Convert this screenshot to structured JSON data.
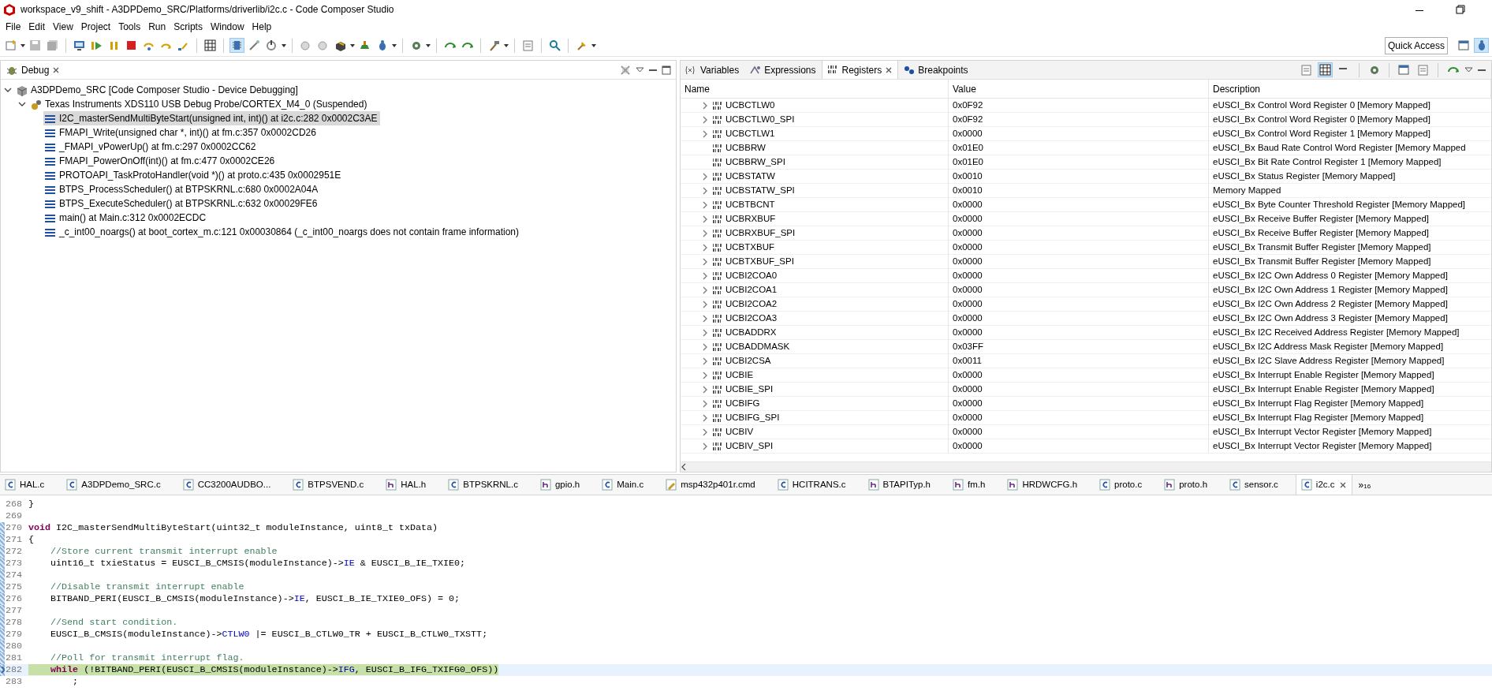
{
  "window": {
    "title": "workspace_v9_shift - A3DPDemo_SRC/Platforms/driverlib/i2c.c - Code Composer Studio"
  },
  "menu": [
    "File",
    "Edit",
    "View",
    "Project",
    "Tools",
    "Run",
    "Scripts",
    "Window",
    "Help"
  ],
  "toolbar": {
    "quick_access": "Quick Access"
  },
  "debug_view": {
    "title": "Debug",
    "tree": [
      {
        "label": "A3DPDemo_SRC [Code Composer Studio - Device Debugging]",
        "kind": "launch",
        "expanded": true,
        "selected": false,
        "children": [
          {
            "label": "Texas Instruments XDS110 USB Debug Probe/CORTEX_M4_0 (Suspended)",
            "kind": "target",
            "expanded": true,
            "selected": false,
            "children": [
              {
                "label": "I2C_masterSendMultiByteStart(unsigned int, int)() at i2c.c:282 0x0002C3AE",
                "kind": "frame",
                "selected": true
              },
              {
                "label": "FMAPI_Write(unsigned char *, int)() at fm.c:357 0x0002CD26",
                "kind": "frame",
                "selected": false
              },
              {
                "label": "_FMAPI_vPowerUp() at fm.c:297 0x0002CC62",
                "kind": "frame",
                "selected": false
              },
              {
                "label": "FMAPI_PowerOnOff(int)() at fm.c:477 0x0002CE26",
                "kind": "frame",
                "selected": false
              },
              {
                "label": "PROTOAPI_TaskProtoHandler(void *)() at proto.c:435 0x0002951E",
                "kind": "frame",
                "selected": false
              },
              {
                "label": "BTPS_ProcessScheduler() at BTPSKRNL.c:680 0x0002A04A",
                "kind": "frame",
                "selected": false
              },
              {
                "label": "BTPS_ExecuteScheduler() at BTPSKRNL.c:632 0x00029FE6",
                "kind": "frame",
                "selected": false
              },
              {
                "label": "main() at Main.c:312 0x0002ECDC",
                "kind": "frame",
                "selected": false
              },
              {
                "label": "_c_int00_noargs() at boot_cortex_m.c:121 0x00030864  (_c_int00_noargs does not contain frame information)",
                "kind": "frame",
                "selected": false
              }
            ]
          }
        ]
      }
    ]
  },
  "registers_view": {
    "tabs": [
      {
        "label": "Variables",
        "kind": "variables",
        "selected": false
      },
      {
        "label": "Expressions",
        "kind": "expressions",
        "selected": false
      },
      {
        "label": "Registers",
        "kind": "registers",
        "selected": true
      },
      {
        "label": "Breakpoints",
        "kind": "breakpoints",
        "selected": false
      }
    ],
    "columns": [
      "Name",
      "Value",
      "Description"
    ],
    "rows": [
      {
        "name": "UCBCTLW0",
        "value": "0x0F92",
        "description": "eUSCI_Bx Control Word Register 0 [Memory Mapped]",
        "expandable": true
      },
      {
        "name": "UCBCTLW0_SPI",
        "value": "0x0F92",
        "description": "eUSCI_Bx Control Word Register 0 [Memory Mapped]",
        "expandable": true
      },
      {
        "name": "UCBCTLW1",
        "value": "0x0000",
        "description": "eUSCI_Bx Control Word Register 1 [Memory Mapped]",
        "expandable": true
      },
      {
        "name": "UCBBRW",
        "value": "0x01E0",
        "description": "eUSCI_Bx Baud Rate Control Word Register [Memory Mapped",
        "expandable": false
      },
      {
        "name": "UCBBRW_SPI",
        "value": "0x01E0",
        "description": "eUSCI_Bx Bit Rate Control Register 1 [Memory Mapped]",
        "expandable": false
      },
      {
        "name": "UCBSTATW",
        "value": "0x0010",
        "description": "eUSCI_Bx Status Register [Memory Mapped]",
        "expandable": true
      },
      {
        "name": "UCBSTATW_SPI",
        "value": "0x0010",
        "description": "Memory Mapped",
        "expandable": true
      },
      {
        "name": "UCBTBCNT",
        "value": "0x0000",
        "description": "eUSCI_Bx Byte Counter Threshold Register [Memory Mapped]",
        "expandable": true
      },
      {
        "name": "UCBRXBUF",
        "value": "0x0000",
        "description": "eUSCI_Bx Receive Buffer Register [Memory Mapped]",
        "expandable": true
      },
      {
        "name": "UCBRXBUF_SPI",
        "value": "0x0000",
        "description": "eUSCI_Bx Receive Buffer Register [Memory Mapped]",
        "expandable": true
      },
      {
        "name": "UCBTXBUF",
        "value": "0x0000",
        "description": "eUSCI_Bx Transmit Buffer Register [Memory Mapped]",
        "expandable": true
      },
      {
        "name": "UCBTXBUF_SPI",
        "value": "0x0000",
        "description": "eUSCI_Bx Transmit Buffer Register [Memory Mapped]",
        "expandable": true
      },
      {
        "name": "UCBI2COA0",
        "value": "0x0000",
        "description": "eUSCI_Bx I2C Own Address 0 Register [Memory Mapped]",
        "expandable": true
      },
      {
        "name": "UCBI2COA1",
        "value": "0x0000",
        "description": "eUSCI_Bx I2C Own Address 1 Register [Memory Mapped]",
        "expandable": true
      },
      {
        "name": "UCBI2COA2",
        "value": "0x0000",
        "description": "eUSCI_Bx I2C Own Address 2 Register [Memory Mapped]",
        "expandable": true
      },
      {
        "name": "UCBI2COA3",
        "value": "0x0000",
        "description": "eUSCI_Bx I2C Own Address 3 Register [Memory Mapped]",
        "expandable": true
      },
      {
        "name": "UCBADDRX",
        "value": "0x0000",
        "description": "eUSCI_Bx I2C Received Address Register [Memory Mapped]",
        "expandable": true
      },
      {
        "name": "UCBADDMASK",
        "value": "0x03FF",
        "description": "eUSCI_Bx I2C Address Mask Register [Memory Mapped]",
        "expandable": true
      },
      {
        "name": "UCBI2CSA",
        "value": "0x0011",
        "description": "eUSCI_Bx I2C Slave Address Register [Memory Mapped]",
        "expandable": true
      },
      {
        "name": "UCBIE",
        "value": "0x0000",
        "description": "eUSCI_Bx Interrupt Enable Register [Memory Mapped]",
        "expandable": true
      },
      {
        "name": "UCBIE_SPI",
        "value": "0x0000",
        "description": "eUSCI_Bx Interrupt Enable Register [Memory Mapped]",
        "expandable": true
      },
      {
        "name": "UCBIFG",
        "value": "0x0000",
        "description": "eUSCI_Bx Interrupt Flag Register [Memory Mapped]",
        "expandable": true
      },
      {
        "name": "UCBIFG_SPI",
        "value": "0x0000",
        "description": "eUSCI_Bx Interrupt Flag Register [Memory Mapped]",
        "expandable": true
      },
      {
        "name": "UCBIV",
        "value": "0x0000",
        "description": "eUSCI_Bx Interrupt Vector Register [Memory Mapped]",
        "expandable": true
      },
      {
        "name": "UCBIV_SPI",
        "value": "0x0000",
        "description": "eUSCI_Bx Interrupt Vector Register [Memory Mapped]",
        "expandable": true
      }
    ]
  },
  "editor": {
    "tabs": [
      {
        "label": "HAL.c",
        "kind": "c",
        "selected": false
      },
      {
        "label": "A3DPDemo_SRC.c",
        "kind": "c",
        "selected": false
      },
      {
        "label": "CC3200AUDBO...",
        "kind": "c",
        "selected": false
      },
      {
        "label": "BTPSVEND.c",
        "kind": "c",
        "selected": false
      },
      {
        "label": "HAL.h",
        "kind": "h",
        "selected": false
      },
      {
        "label": "BTPSKRNL.c",
        "kind": "c",
        "selected": false
      },
      {
        "label": "gpio.h",
        "kind": "h",
        "selected": false
      },
      {
        "label": "Main.c",
        "kind": "c",
        "selected": false
      },
      {
        "label": "msp432p401r.cmd",
        "kind": "cmd",
        "selected": false
      },
      {
        "label": "HCITRANS.c",
        "kind": "c",
        "selected": false
      },
      {
        "label": "BTAPITyp.h",
        "kind": "h",
        "selected": false
      },
      {
        "label": "fm.h",
        "kind": "h",
        "selected": false
      },
      {
        "label": "HRDWCFG.h",
        "kind": "h",
        "selected": false
      },
      {
        "label": "proto.c",
        "kind": "c",
        "selected": false
      },
      {
        "label": "proto.h",
        "kind": "h",
        "selected": false
      },
      {
        "label": "sensor.c",
        "kind": "c",
        "selected": false
      },
      {
        "label": "i2c.c",
        "kind": "c",
        "selected": true
      }
    ],
    "overflow": {
      "symbol": "»",
      "count": "16"
    },
    "lines": [
      {
        "number": "268",
        "marked": false,
        "current": false,
        "tokens": [
          {
            "kind": "plain",
            "text": "}"
          }
        ]
      },
      {
        "number": "269",
        "marked": false,
        "current": false
      },
      {
        "number": "270",
        "marked": true,
        "current": false,
        "tokens": [
          {
            "kind": "keyword",
            "text": "void"
          },
          {
            "kind": "plain",
            "text": " I2C_masterSendMultiByteStart(uint32_t moduleInstance, uint8_t txData)"
          }
        ]
      },
      {
        "number": "271",
        "marked": true,
        "current": false,
        "tokens": [
          {
            "kind": "plain",
            "text": "{"
          }
        ]
      },
      {
        "number": "272",
        "marked": true,
        "current": false,
        "tokens": [
          {
            "kind": "comment",
            "text": "    //Store current transmit interrupt enable"
          }
        ]
      },
      {
        "number": "273",
        "marked": true,
        "current": false,
        "tokens": [
          {
            "kind": "plain",
            "text": "    uint16_t txieStatus = EUSCI_B_CMSIS(moduleInstance)->"
          },
          {
            "kind": "field",
            "text": "IE"
          },
          {
            "kind": "plain",
            "text": " & EUSCI_B_IE_TXIE0;"
          }
        ]
      },
      {
        "number": "274",
        "marked": true,
        "current": false
      },
      {
        "number": "275",
        "marked": true,
        "current": false,
        "tokens": [
          {
            "kind": "comment",
            "text": "    //Disable transmit interrupt enable"
          }
        ]
      },
      {
        "number": "276",
        "marked": true,
        "current": false,
        "tokens": [
          {
            "kind": "plain",
            "text": "    BITBAND_PERI(EUSCI_B_CMSIS(moduleInstance)->"
          },
          {
            "kind": "field",
            "text": "IE"
          },
          {
            "kind": "plain",
            "text": ", EUSCI_B_IE_TXIE0_OFS) = 0;"
          }
        ]
      },
      {
        "number": "277",
        "marked": true,
        "current": false
      },
      {
        "number": "278",
        "marked": true,
        "current": false,
        "tokens": [
          {
            "kind": "comment",
            "text": "    //Send start condition."
          }
        ]
      },
      {
        "number": "279",
        "marked": true,
        "current": false,
        "tokens": [
          {
            "kind": "plain",
            "text": "    EUSCI_B_CMSIS(moduleInstance)->"
          },
          {
            "kind": "field",
            "text": "CTLW0"
          },
          {
            "kind": "plain",
            "text": " |= EUSCI_B_CTLW0_TR + EUSCI_B_CTLW0_TXSTT;"
          }
        ]
      },
      {
        "number": "280",
        "marked": true,
        "current": false
      },
      {
        "number": "281",
        "marked": true,
        "current": false,
        "tokens": [
          {
            "kind": "comment",
            "text": "    //Poll for transmit interrupt flag."
          }
        ]
      },
      {
        "number": "282",
        "marked": true,
        "current": true,
        "tokens": [
          {
            "kind": "keyword",
            "text": "    while"
          },
          {
            "kind": "plain",
            "text": " (!BITBAND_PERI(EUSCI_B_CMSIS(moduleInstance)->"
          },
          {
            "kind": "field",
            "text": "IFG"
          },
          {
            "kind": "plain",
            "text": ", EUSCI_B_IFG_TXIFG0_OFS))"
          }
        ]
      },
      {
        "number": "283",
        "marked": false,
        "current": false,
        "tokens": [
          {
            "kind": "plain",
            "text": "        ;"
          }
        ]
      }
    ]
  }
}
